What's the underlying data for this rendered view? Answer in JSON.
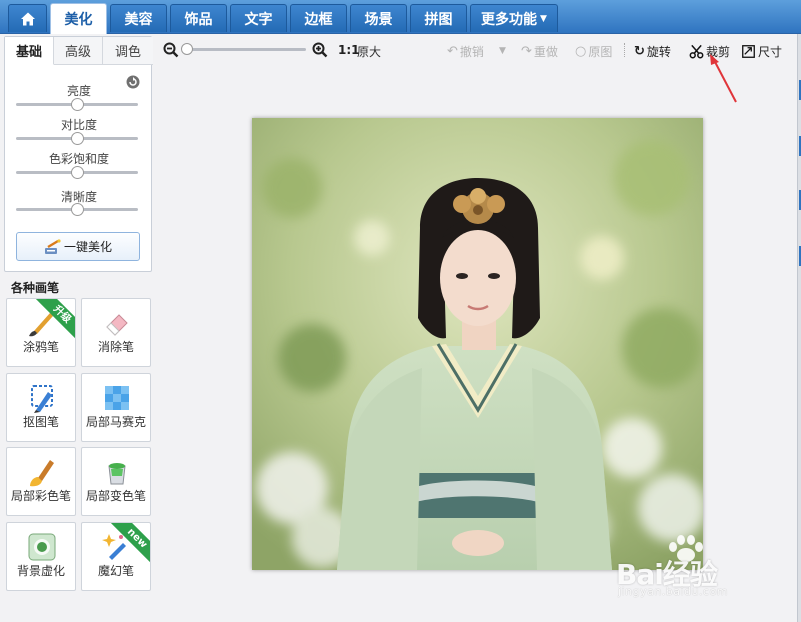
{
  "menu": {
    "home_icon": "home-icon",
    "tabs": [
      "美化",
      "美容",
      "饰品",
      "文字",
      "边框",
      "场景",
      "拼图"
    ],
    "more_label": "更多功能",
    "active_tab": "美化"
  },
  "zoom": {
    "ratio_label": "1:1",
    "original_label": "原大",
    "level": 0
  },
  "toolbar": {
    "undo_label": "撤销",
    "redo_label": "重做",
    "original_label": "原图",
    "rotate_label": "旋转",
    "crop_label": "裁剪",
    "size_label": "尺寸"
  },
  "left_panel": {
    "tabs": [
      "基础",
      "高级",
      "调色"
    ],
    "active_tab": "基础",
    "sliders": [
      {
        "label": "亮度",
        "level": 0.5
      },
      {
        "label": "对比度",
        "level": 0.5
      },
      {
        "label": "色彩饱和度",
        "level": 0.5
      },
      {
        "label": "清晰度",
        "level": 0.5
      }
    ],
    "one_click_label": "一键美化"
  },
  "brushes": {
    "title": "各种画笔",
    "items": [
      {
        "label": "涂鸦笔",
        "ribbon": "升级"
      },
      {
        "label": "消除笔",
        "ribbon": ""
      },
      {
        "label": "抠图笔",
        "ribbon": ""
      },
      {
        "label": "局部马赛克",
        "ribbon": ""
      },
      {
        "label": "局部彩色笔",
        "ribbon": ""
      },
      {
        "label": "局部变色笔",
        "ribbon": ""
      },
      {
        "label": "背景虚化",
        "ribbon": ""
      },
      {
        "label": "魔幻笔",
        "ribbon": "new"
      }
    ]
  },
  "watermark": {
    "main": "Bai经验",
    "sub": "jingyan.baidu.com"
  },
  "colors": {
    "menu_blue": "#2f74c0",
    "ribbon_green": "#2ea04b",
    "annotation_red": "#e0353a"
  }
}
